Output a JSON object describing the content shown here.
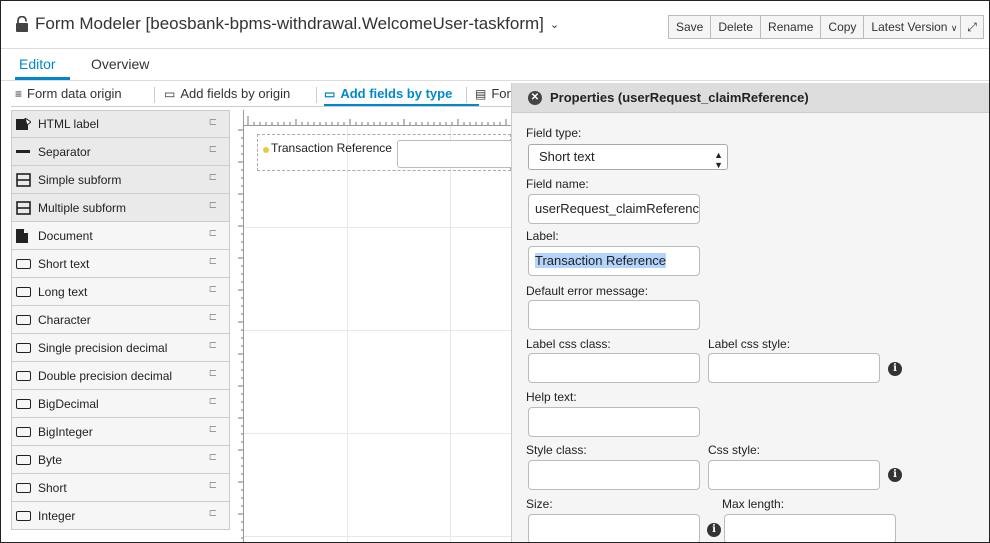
{
  "header": {
    "title": "Form Modeler [beosbank-bpms-withdrawal.WelcomeUser-taskform]",
    "title_chevron": "⌄",
    "buttons": {
      "save": "Save",
      "delete": "Delete",
      "rename": "Rename",
      "copy": "Copy",
      "latest_version": "Latest Version"
    }
  },
  "tabs": {
    "editor": "Editor",
    "overview": "Overview"
  },
  "toolbar": {
    "form_data_origin": "Form data origin",
    "add_fields_by_origin": "Add fields by origin",
    "add_fields_by_type": "Add fields by type",
    "form_props": "For"
  },
  "palette": {
    "items": [
      {
        "label": "HTML label",
        "icon": "html-label-icon"
      },
      {
        "label": "Separator",
        "icon": "separator-icon"
      },
      {
        "label": "Simple subform",
        "icon": "subform-icon"
      },
      {
        "label": "Multiple subform",
        "icon": "subform-icon"
      },
      {
        "label": "Document",
        "icon": "document-icon"
      },
      {
        "label": "Short text",
        "icon": "textbox-icon"
      },
      {
        "label": "Long text",
        "icon": "textbox-icon"
      },
      {
        "label": "Character",
        "icon": "textbox-icon"
      },
      {
        "label": "Single precision decimal",
        "icon": "textbox-icon"
      },
      {
        "label": "Double precision decimal",
        "icon": "textbox-icon"
      },
      {
        "label": "BigDecimal",
        "icon": "textbox-icon"
      },
      {
        "label": "BigInteger",
        "icon": "textbox-icon"
      },
      {
        "label": "Byte",
        "icon": "textbox-icon"
      },
      {
        "label": "Short",
        "icon": "textbox-icon"
      },
      {
        "label": "Integer",
        "icon": "textbox-icon"
      }
    ]
  },
  "canvas": {
    "field_label": "Transaction Reference"
  },
  "properties": {
    "title": "Properties (userRequest_claimReference)",
    "field_type_label": "Field type:",
    "field_type_value": "Short text",
    "field_name_label": "Field name:",
    "field_name_value": "userRequest_claimReference",
    "label_label": "Label:",
    "label_value": "Transaction Reference",
    "default_error_label": "Default error message:",
    "label_css_class_label": "Label css class:",
    "label_css_style_label": "Label css style:",
    "help_text_label": "Help text:",
    "style_class_label": "Style class:",
    "css_style_label": "Css style:",
    "size_label": "Size:",
    "max_length_label": "Max length:"
  },
  "colors": {
    "accent": "#0088ce",
    "selection": "#b3d4fc"
  }
}
